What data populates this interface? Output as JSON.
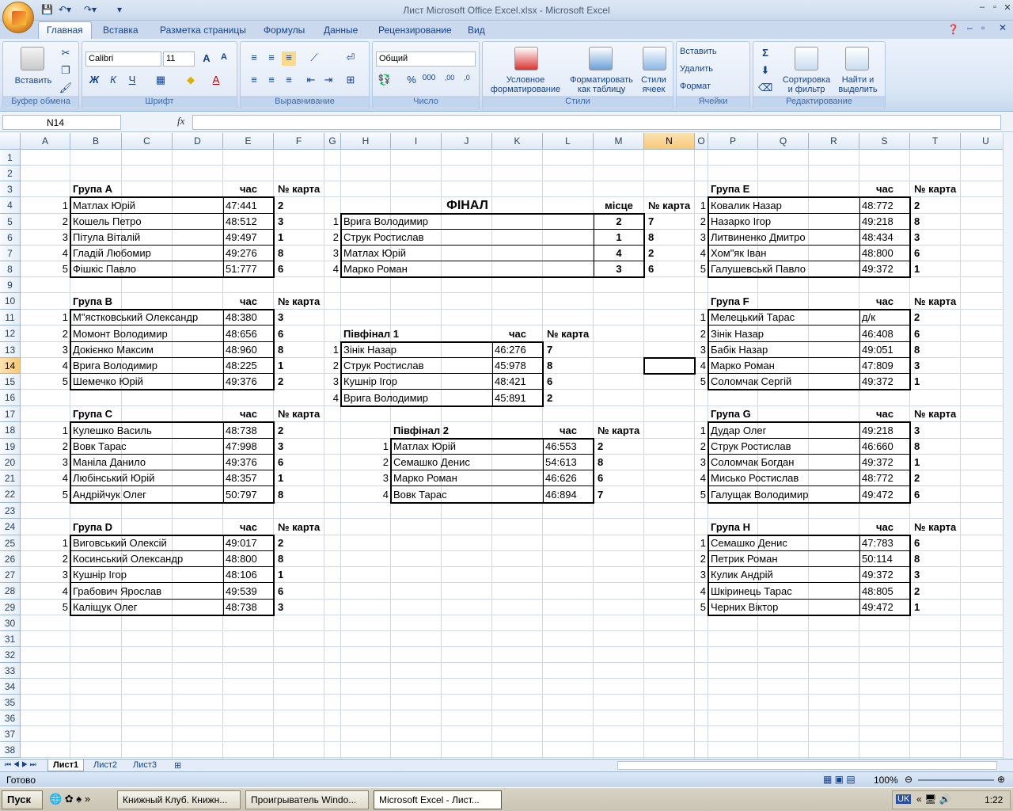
{
  "window": {
    "title": "Лист Microsoft Office Excel.xlsx - Microsoft Excel"
  },
  "ribbon": {
    "tabs": [
      "Главная",
      "Вставка",
      "Разметка страницы",
      "Формулы",
      "Данные",
      "Рецензирование",
      "Вид"
    ],
    "active_tab": "Главная",
    "clipboard": {
      "paste": "Вставить",
      "label": "Буфер обмена"
    },
    "font": {
      "name": "Calibri",
      "size": "11",
      "bold": "Ж",
      "italic": "К",
      "underline": "Ч",
      "label": "Шрифт"
    },
    "alignment": {
      "label": "Выравнивание"
    },
    "number": {
      "format": "Общий",
      "label": "Число"
    },
    "styles": {
      "conditional": "Условное форматирование",
      "as_table": "Форматировать как таблицу",
      "cell_styles": "Стили ячеек",
      "label": "Стили"
    },
    "cells": {
      "insert": "Вставить",
      "delete": "Удалить",
      "format": "Формат",
      "label": "Ячейки"
    },
    "editing": {
      "sort": "Сортировка и фильтр",
      "find": "Найти и выделить",
      "label": "Редактирование"
    }
  },
  "formula_bar": {
    "name_box": "N14",
    "fx": "fx",
    "content": ""
  },
  "columns": [
    "A",
    "B",
    "C",
    "D",
    "E",
    "F",
    "G",
    "H",
    "I",
    "J",
    "K",
    "L",
    "M",
    "N",
    "O",
    "P",
    "Q",
    "R",
    "S",
    "T",
    "U"
  ],
  "selected_column": "N",
  "rows": [
    "1",
    "2",
    "3",
    "4",
    "5",
    "6",
    "7",
    "8",
    "9",
    "10",
    "11",
    "12",
    "13",
    "14",
    "15",
    "16",
    "17",
    "18",
    "19",
    "20",
    "21",
    "22",
    "23",
    "24",
    "25",
    "26",
    "27",
    "28",
    "29",
    "30",
    "31",
    "32",
    "33",
    "34",
    "35",
    "36",
    "37",
    "38"
  ],
  "selected_row": "14",
  "labels": {
    "time": "час",
    "card": "№ карта",
    "place": "місце"
  },
  "groups": {
    "A": {
      "title": "Група А",
      "rows": [
        [
          "1",
          "Матлах Юрій",
          "47:441",
          "2"
        ],
        [
          "2",
          "Кошель Петро",
          "48:512",
          "3"
        ],
        [
          "3",
          "Пітула Віталій",
          "49:497",
          "1"
        ],
        [
          "4",
          "Гладій Любомир",
          "49:276",
          "8"
        ],
        [
          "5",
          "Фішкіс Павло",
          "51:777",
          "6"
        ]
      ]
    },
    "B": {
      "title": "Група В",
      "rows": [
        [
          "1",
          "М\"ястковський Олександр",
          "48:380",
          "3"
        ],
        [
          "2",
          "Момонт Володимир",
          "48:656",
          "6"
        ],
        [
          "3",
          "Докієнко Максим",
          "48:960",
          "8"
        ],
        [
          "4",
          "Врига Володимир",
          "48:225",
          "1"
        ],
        [
          "5",
          "Шемечко Юрій",
          "49:376",
          "2"
        ]
      ]
    },
    "C": {
      "title": "Група С",
      "rows": [
        [
          "1",
          "Кулешко Василь",
          "48:738",
          "2"
        ],
        [
          "2",
          "Вовк Тарас",
          "47:998",
          "3"
        ],
        [
          "3",
          "Маніла Данило",
          "49:376",
          "6"
        ],
        [
          "4",
          "Любінський Юрій",
          "48:357",
          "1"
        ],
        [
          "5",
          "Андрійчук Олег",
          "50:797",
          "8"
        ]
      ]
    },
    "D": {
      "title": "Група D",
      "rows": [
        [
          "1",
          "Виговський Олексій",
          "49:017",
          "2"
        ],
        [
          "2",
          "Косинський Олександр",
          "48:800",
          "8"
        ],
        [
          "3",
          "Кушнір Ігор",
          "48:106",
          "1"
        ],
        [
          "4",
          "Грабович Ярослав",
          "49:539",
          "6"
        ],
        [
          "5",
          "Каліщук Олег",
          "48:738",
          "3"
        ]
      ]
    },
    "E": {
      "title": "Група E",
      "rows": [
        [
          "1",
          "Ковалик Назар",
          "48:772",
          "2"
        ],
        [
          "2",
          "Назарко Ігор",
          "49:218",
          "8"
        ],
        [
          "3",
          "Литвиненко Дмитро",
          "48:434",
          "3"
        ],
        [
          "4",
          "Хом\"як Іван",
          "48:800",
          "6"
        ],
        [
          "5",
          "Галушевськй Павло",
          "49:372",
          "1"
        ]
      ]
    },
    "F": {
      "title": "Група F",
      "rows": [
        [
          "1",
          "Мелецький Тарас",
          "д/к",
          "2"
        ],
        [
          "2",
          "Зінік Назар",
          "46:408",
          "6"
        ],
        [
          "3",
          "Бабік Назар",
          "49:051",
          "8"
        ],
        [
          "4",
          "Марко Роман",
          "47:809",
          "3"
        ],
        [
          "5",
          "Соломчак Сергій",
          "49:372",
          "1"
        ]
      ]
    },
    "G": {
      "title": "Група G",
      "rows": [
        [
          "1",
          "Дудар Олег",
          "49:218",
          "3"
        ],
        [
          "2",
          "Струк Ростислав",
          "46:660",
          "8"
        ],
        [
          "3",
          "Соломчак Богдан",
          "49:372",
          "1"
        ],
        [
          "4",
          "Мисько Ростислав",
          "48:772",
          "2"
        ],
        [
          "5",
          "Галущак Володимир",
          "49:472",
          "6"
        ]
      ]
    },
    "H": {
      "title": "Група H",
      "rows": [
        [
          "1",
          "Семашко Денис",
          "47:783",
          "6"
        ],
        [
          "2",
          "Петрик Роман",
          "50:114",
          "8"
        ],
        [
          "3",
          "Кулик Андрій",
          "49:372",
          "3"
        ],
        [
          "4",
          "Шкіринець Тарас",
          "48:805",
          "2"
        ],
        [
          "5",
          "Черних Віктор",
          "49:472",
          "1"
        ]
      ]
    }
  },
  "final": {
    "title": "ФІНАЛ",
    "rows": [
      [
        "1",
        "Врига Володимир",
        "2",
        "7"
      ],
      [
        "2",
        "Струк Ростислав",
        "1",
        "8"
      ],
      [
        "3",
        "Матлах Юрій",
        "4",
        "2"
      ],
      [
        "4",
        "Марко Роман",
        "3",
        "6"
      ]
    ]
  },
  "semi1": {
    "title": "Півфінал 1",
    "rows": [
      [
        "1",
        "Зінік Назар",
        "46:276",
        "7"
      ],
      [
        "2",
        "Струк Ростислав",
        "45:978",
        "8"
      ],
      [
        "3",
        "Кушнір Ігор",
        "48:421",
        "6"
      ],
      [
        "4",
        "Врига Володимир",
        "45:891",
        "2"
      ]
    ]
  },
  "semi2": {
    "title": "Півфінал 2",
    "rows": [
      [
        "1",
        "Матлах Юрій",
        "46:553",
        "2"
      ],
      [
        "2",
        "Семашко Денис",
        "54:613",
        "8"
      ],
      [
        "3",
        "Марко Роман",
        "46:626",
        "6"
      ],
      [
        "4",
        "Вовк Тарас",
        "46:894",
        "7"
      ]
    ]
  },
  "sheets": [
    "Лист1",
    "Лист2",
    "Лист3"
  ],
  "status": {
    "ready": "Готово",
    "zoom": "100%"
  },
  "taskbar": {
    "start": "Пуск",
    "tasks": [
      "Книжный Клуб. Книжн...",
      "Проигрыватель Windo...",
      "Microsoft Excel - Лист..."
    ],
    "lang": "UK",
    "clock": "1:22"
  }
}
